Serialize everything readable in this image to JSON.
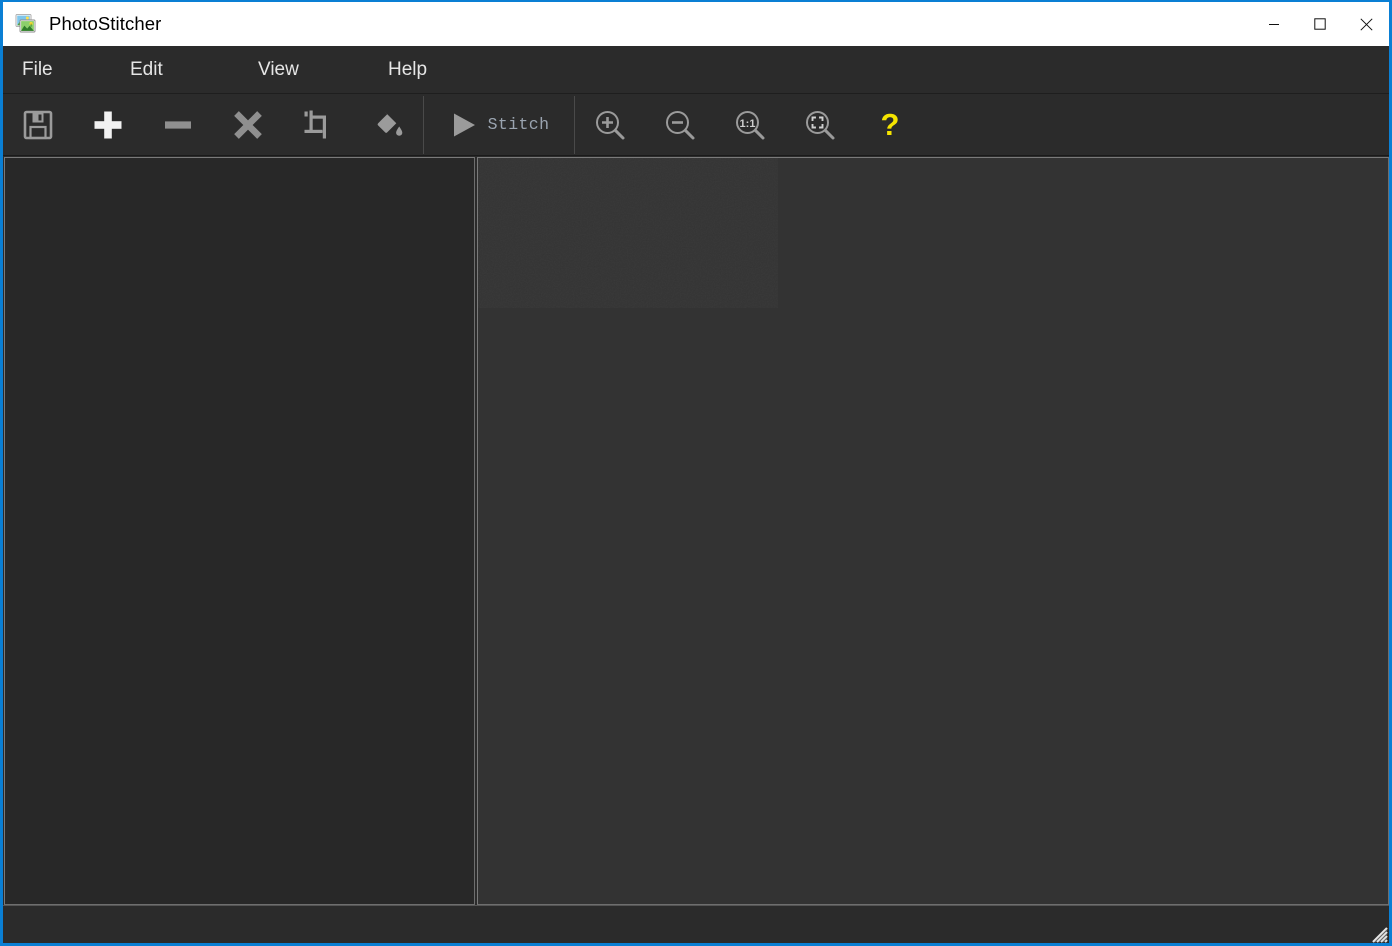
{
  "window": {
    "title": "PhotoStitcher",
    "app_icon": "photo-stack-icon",
    "accent_border_color": "#0a7fd4",
    "titlebar_bg": "#ffffff",
    "chrome_bg": "#2b2b2b",
    "canvas_bg": "#333333",
    "list_panel_bg": "#282828",
    "controls": {
      "minimize": {
        "label": "Minimize",
        "icon": "minimize-icon"
      },
      "maximize": {
        "label": "Maximize",
        "icon": "maximize-icon"
      },
      "close": {
        "label": "Close",
        "icon": "close-icon"
      }
    }
  },
  "menu": {
    "items": [
      {
        "label": "File",
        "name": "menu-file"
      },
      {
        "label": "Edit",
        "name": "menu-edit"
      },
      {
        "label": "View",
        "name": "menu-view"
      },
      {
        "label": "Help",
        "name": "menu-help"
      }
    ]
  },
  "toolbar": {
    "buttons": [
      {
        "label": "Save",
        "icon": "save-floppy-icon"
      },
      {
        "label": "Add images",
        "icon": "plus-icon"
      },
      {
        "label": "Remove image",
        "icon": "minus-icon"
      },
      {
        "label": "Clear all",
        "icon": "cross-icon"
      },
      {
        "label": "Crop",
        "icon": "crop-icon"
      },
      {
        "label": "Fill background",
        "icon": "paint-bucket-icon"
      }
    ],
    "stitch": {
      "label": "Stitch",
      "icon": "play-triangle-icon",
      "label_color": "#9aa4b0"
    },
    "zoom_buttons": [
      {
        "label": "Zoom in",
        "icon": "zoom-in-icon"
      },
      {
        "label": "Zoom out",
        "icon": "zoom-out-icon"
      },
      {
        "label": "Actual size",
        "icon": "zoom-1-1-icon",
        "badge": "1:1"
      },
      {
        "label": "Fit to window",
        "icon": "zoom-fit-icon"
      }
    ],
    "help": {
      "label": "Help",
      "icon": "question-mark-icon",
      "glyph": "?",
      "color": "#f5e400"
    }
  },
  "panels": {
    "image_list": {
      "name": "image-list-panel",
      "placeholder": "",
      "items": []
    },
    "canvas": {
      "name": "preview-canvas",
      "content": ""
    }
  },
  "status_bar": {
    "text": ""
  }
}
